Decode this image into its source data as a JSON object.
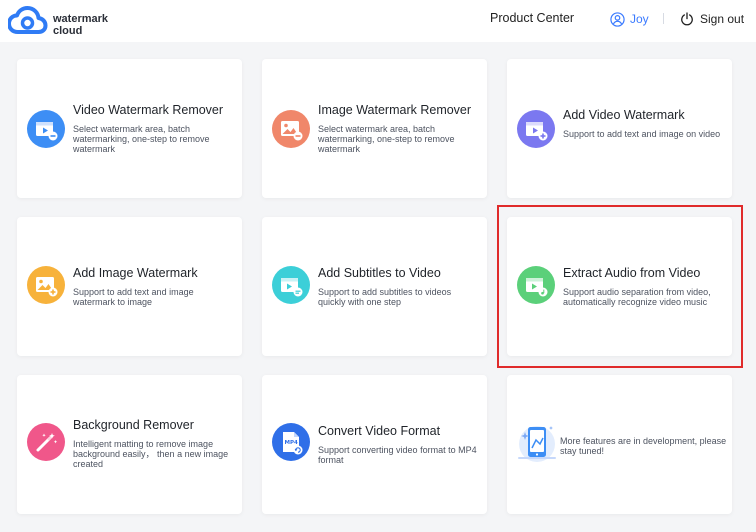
{
  "header": {
    "logo_line1": "watermark",
    "logo_line2": "cloud",
    "product_center": "Product Center",
    "user_name": "Joy",
    "sign_out": "Sign out"
  },
  "cards": [
    {
      "title": "Video Watermark Remover",
      "desc": "Select watermark area, batch watermarking, one-step to remove watermark",
      "icon": "video-watermark-remover-icon",
      "color": "#3d8ef5"
    },
    {
      "title": "Image Watermark Remover",
      "desc": "Select watermark area, batch watermarking, one-step to remove watermark",
      "icon": "image-watermark-remover-icon",
      "color": "#f0876a"
    },
    {
      "title": "Add Video Watermark",
      "desc": "Support to add text and image on video",
      "icon": "add-video-watermark-icon",
      "color": "#7b78f0"
    },
    {
      "title": "Add Image Watermark",
      "desc": "Support to add text and image watermark to image",
      "icon": "add-image-watermark-icon",
      "color": "#f7b23b"
    },
    {
      "title": "Add Subtitles to Video",
      "desc": "Support to add subtitles to videos quickly with one step",
      "icon": "add-subtitles-icon",
      "color": "#3ccfd8"
    },
    {
      "title": "Extract Audio from Video",
      "desc": "Support audio separation from video, automatically recognize video music",
      "icon": "extract-audio-icon",
      "color": "#5bd07a"
    },
    {
      "title": "Background Remover",
      "desc": "Intelligent matting to remove image background easily， then a new image created",
      "icon": "background-remover-icon",
      "color": "#f0578a"
    },
    {
      "title": "Convert Video Format",
      "desc": "Support converting video format to MP4 format",
      "icon": "convert-video-format-icon",
      "color": "#2f6fe8"
    }
  ],
  "dev_card": {
    "text": "More features are in development, please stay tuned!",
    "icon": "in-development-illustration-icon"
  },
  "colors": {
    "accent": "#3b7bff",
    "highlight": "#e02b2b",
    "background": "#f4f5f7"
  }
}
